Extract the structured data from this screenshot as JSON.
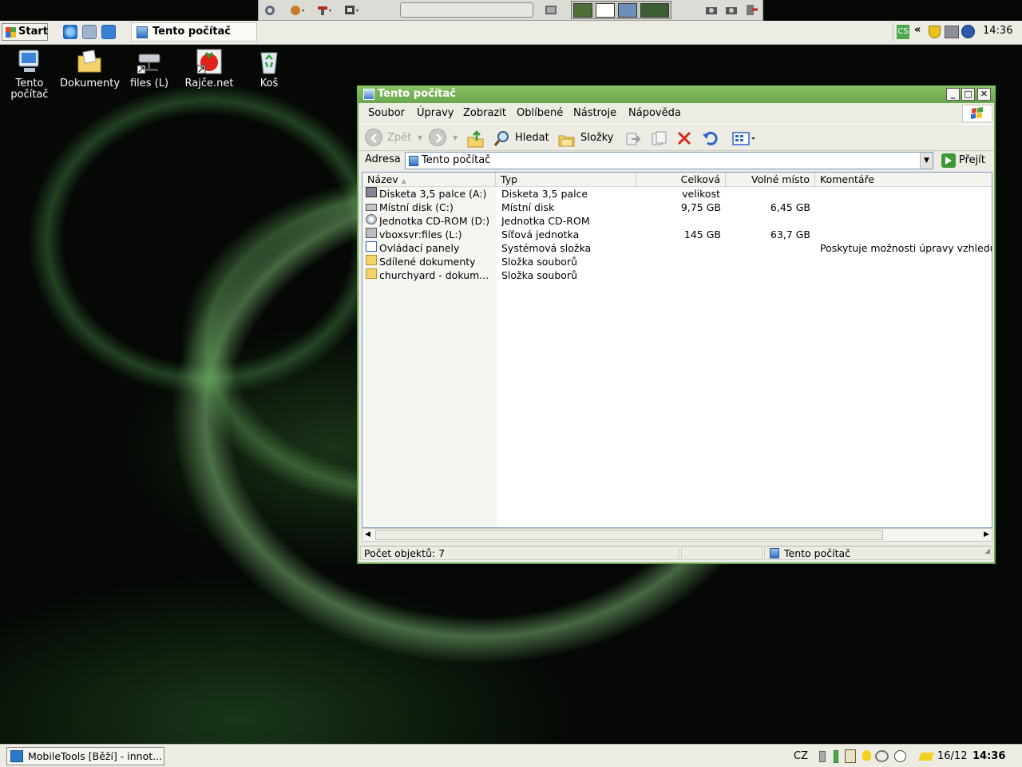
{
  "top_panel": {
    "icons": [
      "settings-icon",
      "app-launcher-icon",
      "tools-icon",
      "workspace-icon",
      "window-icon",
      "workspace-switcher-icon",
      "camera-icon",
      "camera-icon",
      "exit-icon"
    ]
  },
  "taskbar": {
    "start_label": "Start",
    "active_window": "Tento počítač",
    "tray_lang": "CS",
    "tray_expand": "«",
    "clock": "14:36"
  },
  "desktop_icons": [
    {
      "label": "Tento počítač",
      "icon": "computer-icon"
    },
    {
      "label": "Dokumenty",
      "icon": "documents-folder-icon"
    },
    {
      "label": "files (L)",
      "icon": "network-drive-icon"
    },
    {
      "label": "Rajče.net",
      "icon": "rajce-icon"
    },
    {
      "label": "Koš",
      "icon": "recycle-bin-icon"
    }
  ],
  "window": {
    "title": "Tento počítač",
    "menu": [
      "Soubor",
      "Úpravy",
      "Zobrazit",
      "Oblíbené",
      "Nástroje",
      "Nápověda"
    ],
    "toolbar": {
      "back": "Zpět",
      "search": "Hledat",
      "folders": "Složky"
    },
    "address": {
      "label": "Adresa",
      "value": "Tento počítač",
      "go": "Přejít"
    },
    "columns": [
      "Název",
      "Typ",
      "Celková velikost",
      "Volné místo",
      "Komentáře"
    ],
    "rows": [
      {
        "name": "Disketa 3,5 palce (A:)",
        "type": "Disketa 3,5 palce",
        "total": "",
        "free": "",
        "comment": "",
        "icon": "floppy-icon"
      },
      {
        "name": "Místní disk (C:)",
        "type": "Místní disk",
        "total": "9,75 GB",
        "free": "6,45 GB",
        "comment": "",
        "icon": "hard-disk-icon"
      },
      {
        "name": "Jednotka CD-ROM (D:)",
        "type": "Jednotka CD-ROM",
        "total": "",
        "free": "",
        "comment": "",
        "icon": "cdrom-icon"
      },
      {
        "name": "vboxsvr:files (L:)",
        "type": "Síťová jednotka",
        "total": "145 GB",
        "free": "63,7 GB",
        "comment": "",
        "icon": "network-drive-icon"
      },
      {
        "name": "Ovládací panely",
        "type": "Systémová složka",
        "total": "",
        "free": "",
        "comment": "Poskytuje možnosti úpravy vzhledu",
        "icon": "control-panel-icon"
      },
      {
        "name": "Sdílené dokumenty",
        "type": "Složka souborů",
        "total": "",
        "free": "",
        "comment": "",
        "icon": "folder-icon"
      },
      {
        "name": "churchyard - dokum...",
        "type": "Složka souborů",
        "total": "",
        "free": "",
        "comment": "",
        "icon": "folder-icon"
      }
    ],
    "status": {
      "count": "Počet objektů: 7",
      "location": "Tento počítač"
    }
  },
  "bottom_panel": {
    "task": "MobileTools [Běží] - innot...",
    "lang": "CZ",
    "date": "16/12",
    "time": "14:36"
  }
}
